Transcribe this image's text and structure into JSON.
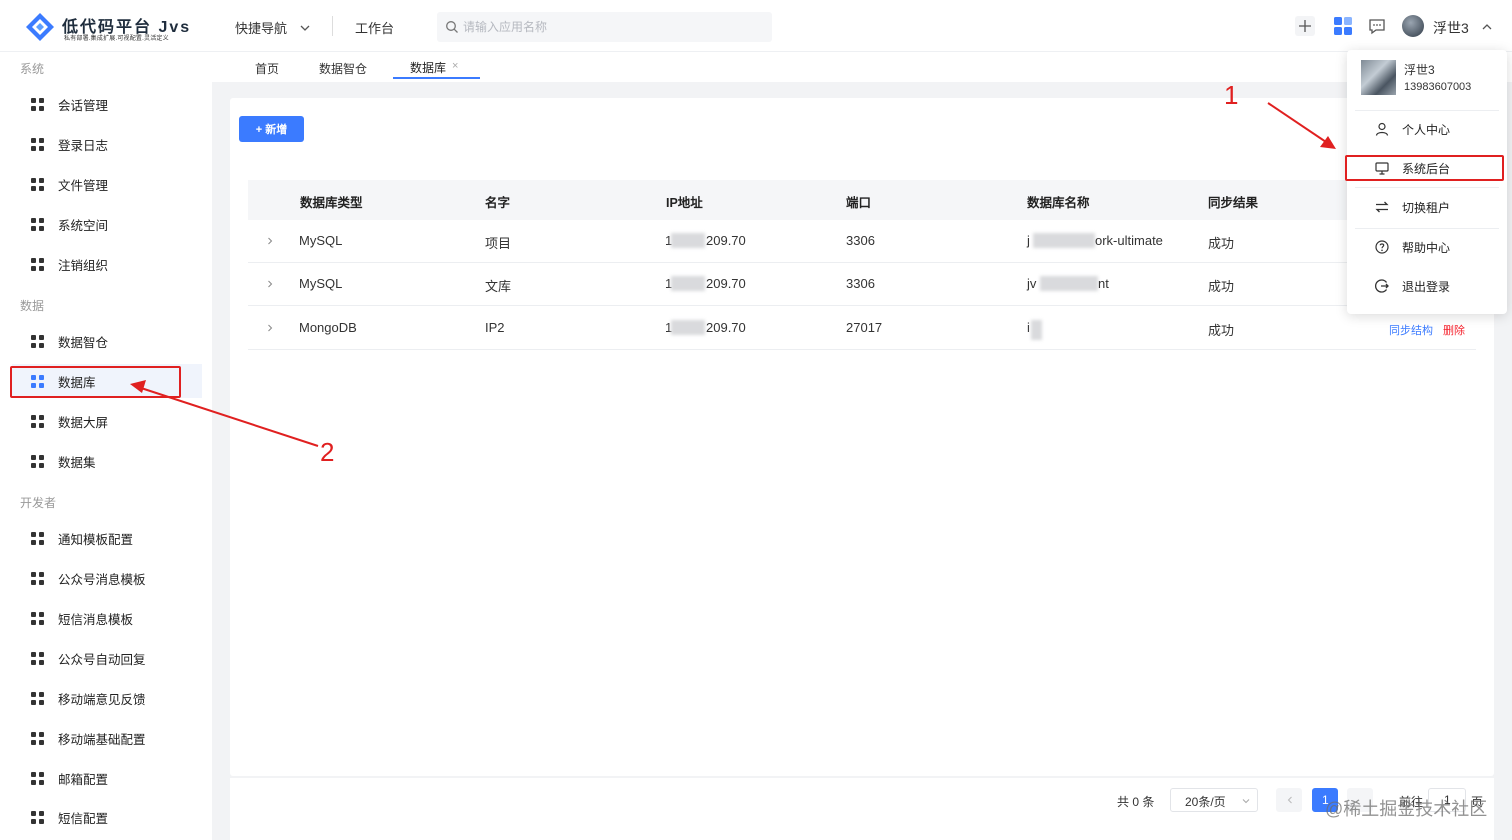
{
  "header": {
    "logo_title": "低代码平台 Jvs",
    "logo_subtitle": "私有部署.集成扩展.可视配置.灵活定义",
    "nav_quick": "快捷导航",
    "nav_workbench": "工作台",
    "search_placeholder": "请输入应用名称",
    "user_name": "浮世3"
  },
  "sidebar": {
    "groups": [
      "系统",
      "数据",
      "开发者"
    ],
    "system_items": [
      "会话管理",
      "登录日志",
      "文件管理",
      "系统空间",
      "注销组织"
    ],
    "data_items": [
      "数据智仓",
      "数据库",
      "数据大屏",
      "数据集"
    ],
    "dev_items": [
      "通知模板配置",
      "公众号消息模板",
      "短信消息模板",
      "公众号自动回复",
      "移动端意见反馈",
      "移动端基础配置",
      "邮箱配置",
      "短信配置"
    ]
  },
  "tabs": [
    "首页",
    "数据智仓",
    "数据库"
  ],
  "tab_close": "×",
  "toolbar": {
    "new_label": "+ 新增"
  },
  "table": {
    "columns": [
      "数据库类型",
      "名字",
      "IP地址",
      "端口",
      "数据库名称",
      "同步结果"
    ],
    "rows": [
      {
        "type": "MySQL",
        "name": "项目",
        "ip_a": "1",
        "ip_b": "209.70",
        "port": "3306",
        "db_a": "j",
        "db_b": "ork-ultimate",
        "result": "成功"
      },
      {
        "type": "MySQL",
        "name": "文库",
        "ip_a": "1",
        "ip_b": "209.70",
        "port": "3306",
        "db_a": "jv",
        "db_b": "nt",
        "result": "成功"
      },
      {
        "type": "MongoDB",
        "name": "IP2",
        "ip_a": "1",
        "ip_b": "209.70",
        "port": "27017",
        "db_a": "i",
        "db_b": "",
        "result": "成功"
      }
    ],
    "op_sync": "同步结构",
    "op_delete": "删除"
  },
  "pagination": {
    "total": "共 0 条",
    "page_size": "20条/页",
    "current": "1",
    "goto": "前往",
    "goto_value": "1",
    "page_suffix": "页"
  },
  "user_menu": {
    "name": "浮世3",
    "phone": "13983607003",
    "items": [
      "个人中心",
      "系统后台",
      "切换租户",
      "帮助中心",
      "退出登录"
    ]
  },
  "annotations": {
    "label1": "1",
    "label2": "2"
  },
  "watermark": "@稀土掘金技术社区",
  "colors": {
    "accent": "#3b7bff",
    "annotation": "#e02020",
    "delete": "#f5222d"
  }
}
